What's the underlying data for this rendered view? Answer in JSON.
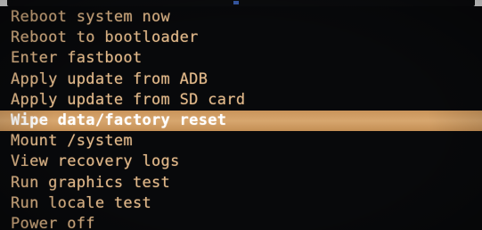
{
  "recovery_menu": {
    "items": [
      {
        "label": "Reboot system now"
      },
      {
        "label": "Reboot to bootloader"
      },
      {
        "label": "Enter fastboot"
      },
      {
        "label": "Apply update from ADB"
      },
      {
        "label": "Apply update from SD card"
      },
      {
        "label": "Wipe data/factory reset"
      },
      {
        "label": "Mount /system"
      },
      {
        "label": "View recovery logs"
      },
      {
        "label": "Run graphics test"
      },
      {
        "label": "Run locale test"
      },
      {
        "label": "Power off"
      }
    ],
    "selected_index": 5
  },
  "colors": {
    "background": "#08090b",
    "text": "#e2b98a",
    "highlight": "#d7a66e",
    "highlight_text": "#ffffff"
  }
}
